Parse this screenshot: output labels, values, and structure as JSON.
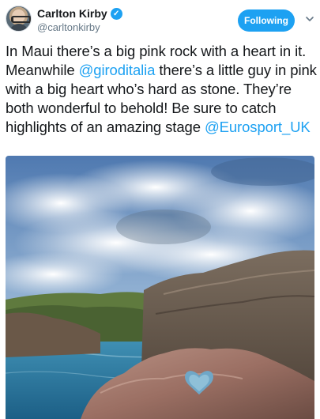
{
  "tweet": {
    "author": {
      "display_name": "Carlton Kirby",
      "handle": "@carltonkirby",
      "verified": true
    },
    "follow_button_label": "Following",
    "text": {
      "part1": "In Maui there’s a big pink rock with a heart in it. Meanwhile ",
      "mention1": "@giroditalia",
      "part2": " there’s a little guy in pink with a big heart who’s hard as stone. They’re both wonderful to behold! Be sure to catch highlights of an amazing stage ",
      "mention2": "@Eurosport_UK"
    },
    "media": {
      "type": "photo"
    }
  },
  "colors": {
    "accent": "#1da1f2",
    "text_primary": "#14171a",
    "text_secondary": "#657786"
  },
  "icons": {
    "verified": "verified-badge-icon",
    "more": "chevron-down-icon"
  }
}
